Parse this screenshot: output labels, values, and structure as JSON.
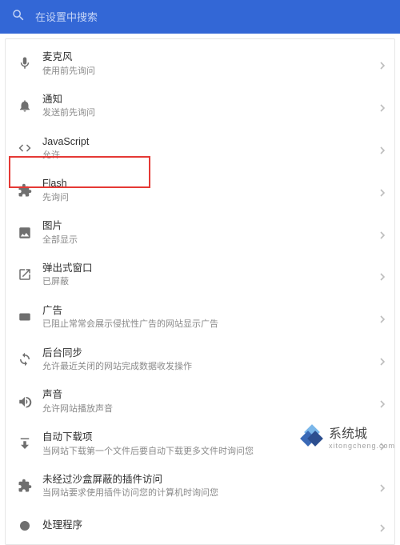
{
  "search": {
    "placeholder": "在设置中搜索"
  },
  "items": [
    {
      "icon": "mic",
      "title": "麦克风",
      "sub": "使用前先询问"
    },
    {
      "icon": "bell",
      "title": "通知",
      "sub": "发送前先询问"
    },
    {
      "icon": "code",
      "title": "JavaScript",
      "sub": "允许"
    },
    {
      "icon": "puzzle",
      "title": "Flash",
      "sub": "先询问"
    },
    {
      "icon": "image",
      "title": "图片",
      "sub": "全部显示"
    },
    {
      "icon": "popup",
      "title": "弹出式窗口",
      "sub": "已屏蔽"
    },
    {
      "icon": "ad",
      "title": "广告",
      "sub": "已阻止常常会展示侵扰性广告的网站显示广告"
    },
    {
      "icon": "sync",
      "title": "后台同步",
      "sub": "允许最近关闭的网站完成数据收发操作"
    },
    {
      "icon": "volume",
      "title": "声音",
      "sub": "允许网站播放声音"
    },
    {
      "icon": "download",
      "title": "自动下载项",
      "sub": "当网站下载第一个文件后要自动下载更多文件时询问您"
    },
    {
      "icon": "puzzle",
      "title": "未经过沙盒屏蔽的插件访问",
      "sub": "当网站要求使用插件访问您的计算机时询问您"
    },
    {
      "icon": "handle",
      "title": "处理程序",
      "sub": ""
    }
  ],
  "watermark": {
    "cn": "系统城",
    "en": "xitongcheng.com"
  }
}
